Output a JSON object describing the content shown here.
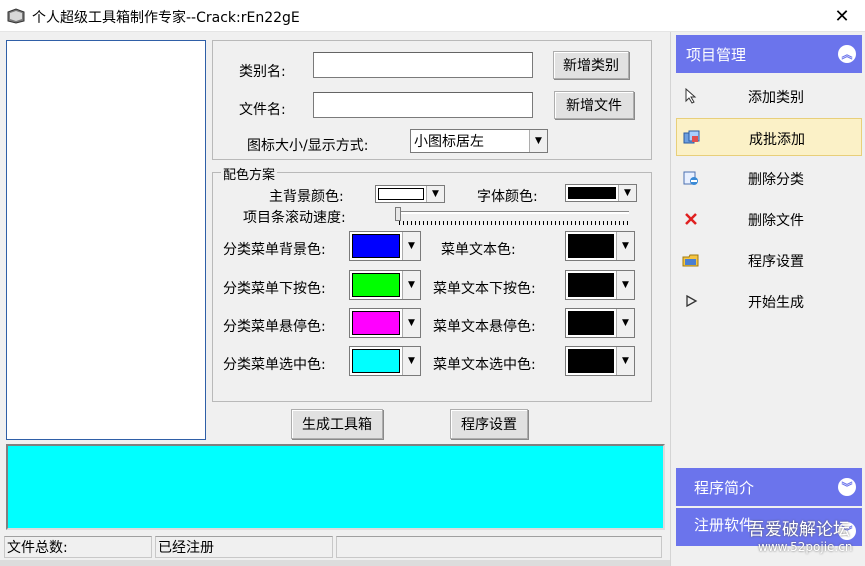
{
  "window": {
    "title": "个人超级工具箱制作专家--Crack:rEn22gE",
    "close_glyph": "✕"
  },
  "form": {
    "category_label": "类别名:",
    "category_value": "",
    "add_category_button": "新增类别",
    "file_label": "文件名:",
    "file_value": "",
    "add_file_button": "新增文件",
    "icon_size_label": "图标大小/显示方式:",
    "icon_size_value": "小图标居左"
  },
  "colors_group": {
    "legend": "配色方案",
    "main_bg_label": "主背景颜色:",
    "main_bg_color": "#ffffff",
    "font_color_label": "字体颜色:",
    "font_color": "#000000",
    "scroll_speed_label": "项目条滚动速度:",
    "rows": [
      {
        "left_label": "分类菜单背景色:",
        "left_color": "#0000ff",
        "right_label": "菜单文本色:",
        "right_color": "#000000"
      },
      {
        "left_label": "分类菜单下按色:",
        "left_color": "#00ff00",
        "right_label": "菜单文本下按色:",
        "right_color": "#000000"
      },
      {
        "left_label": "分类菜单悬停色:",
        "left_color": "#ff00ff",
        "right_label": "菜单文本悬停色:",
        "right_color": "#000000"
      },
      {
        "left_label": "分类菜单选中色:",
        "left_color": "#00ffff",
        "right_label": "菜单文本选中色:",
        "right_color": "#000000"
      }
    ]
  },
  "actions": {
    "generate_button": "生成工具箱",
    "settings_button": "程序设置"
  },
  "status": {
    "file_count": "文件总数:",
    "registered": "已经注册",
    "extra": ""
  },
  "right_panel": {
    "header": "项目管理",
    "items": [
      {
        "label": "添加类别",
        "icon": "cursor-icon"
      },
      {
        "label": "成批添加",
        "icon": "batch-add-icon"
      },
      {
        "label": "删除分类",
        "icon": "delete-category-icon"
      },
      {
        "label": "删除文件",
        "icon": "delete-x-icon"
      },
      {
        "label": "程序设置",
        "icon": "settings-folder-icon"
      },
      {
        "label": "开始生成",
        "icon": "play-icon"
      }
    ],
    "section2": "程序简介",
    "section3": "注册软件"
  },
  "watermark": {
    "line1": "吾爱破解论坛",
    "line2": "www.52pojie.cn"
  },
  "theme": {
    "panel_blue": "#6b74ec",
    "active_item_bg": "#fbf1c7",
    "log_area": "#00ffff"
  }
}
